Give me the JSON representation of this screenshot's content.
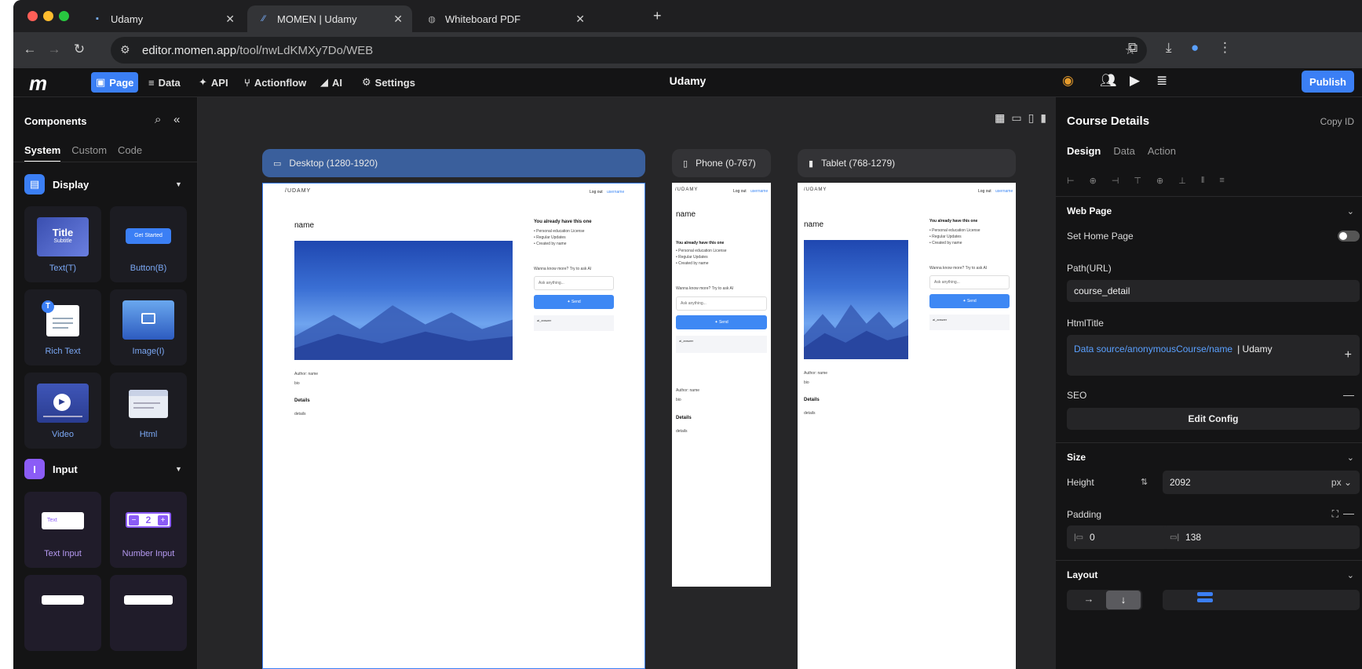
{
  "browser": {
    "tabs": [
      {
        "title": "Udamy"
      },
      {
        "title": "MOMEN | Udamy"
      },
      {
        "title": "Whiteboard PDF"
      }
    ],
    "url_host": "editor.momen.app",
    "url_path": "/tool/nwLdKMXy7Do/WEB"
  },
  "app": {
    "logo": "m",
    "menu": [
      {
        "label": "Page",
        "icon": "page-icon"
      },
      {
        "label": "Data",
        "icon": "database-icon"
      },
      {
        "label": "API",
        "icon": "api-icon"
      },
      {
        "label": "Actionflow",
        "icon": "flow-icon"
      },
      {
        "label": "AI",
        "icon": "ai-icon"
      },
      {
        "label": "Settings",
        "icon": "gear-icon"
      }
    ],
    "title": "Udamy",
    "publish": "Publish"
  },
  "components": {
    "title": "Components",
    "tabs": [
      "System",
      "Custom",
      "Code"
    ],
    "sections": [
      {
        "label": "Display",
        "color": "#3b7ff5",
        "items": [
          "Text(T)",
          "Button(B)",
          "Rich Text",
          "Image(I)",
          "Video",
          "Html"
        ]
      },
      {
        "label": "Input",
        "color": "#8b5cf6",
        "items": [
          "Text Input",
          "Number Input"
        ]
      }
    ],
    "thumb_title": "Title",
    "thumb_subtitle": "Subtitle",
    "thumb_button": "Get Started",
    "thumb_text": "Text",
    "thumb_number": "2"
  },
  "canvas": {
    "devices": [
      {
        "label": "Desktop (1280-1920)",
        "icon": "desktop-icon"
      },
      {
        "label": "Phone (0-767)",
        "icon": "phone-icon"
      },
      {
        "label": "Tablet (768-1279)",
        "icon": "tablet-icon"
      }
    ],
    "preview": {
      "brand": "/UDAMY",
      "logout": "Log out",
      "username": "username",
      "name": "name",
      "already": "You already have this one",
      "bullets": [
        "• Personal education License",
        "• Regular Updates",
        "• Created by name"
      ],
      "wanna": "Wanna know more? Try to ask AI",
      "ask_placeholder": "Ask anything...",
      "send": "Send",
      "answer": "ai_answer",
      "author": "Author: name",
      "bio": "bio",
      "details_head": "Details",
      "details": "details"
    }
  },
  "inspector": {
    "title": "Course Details",
    "copy_id": "Copy ID",
    "tabs": [
      "Design",
      "Data",
      "Action"
    ],
    "web_page": "Web Page",
    "set_home": "Set Home Page",
    "path_label": "Path(URL)",
    "path_value": "course_detail",
    "html_title_label": "HtmlTitle",
    "html_title_source": "Data source/anonymousCourse/name",
    "html_title_suffix": "| Udamy",
    "seo": "SEO",
    "edit_config": "Edit Config",
    "size": "Size",
    "height_label": "Height",
    "height_value": "2092",
    "height_unit": "px",
    "padding_label": "Padding",
    "padding_left": "0",
    "padding_right": "138",
    "layout": "Layout"
  }
}
